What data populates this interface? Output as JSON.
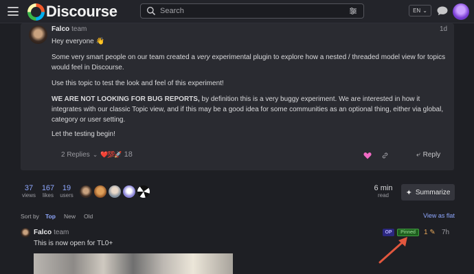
{
  "header": {
    "logo_text": "Discourse",
    "search_placeholder": "Search",
    "language": "EN"
  },
  "post": {
    "author": "Falco",
    "author_group": "team",
    "date": "1d",
    "greeting": "Hey everyone 👋",
    "para1_start": "Some very smart people on our team created a ",
    "para1_em": "very",
    "para1_end": " experimental plugin to explore how a nested / threaded model view for topics would feel in Discourse.",
    "para2": "Use this topic to test the look and feel of this experiment!",
    "para3_bold": "WE ARE NOT LOOKING FOR BUG REPORTS,",
    "para3_rest": " by definition this is a very buggy experiment. We are interested in how it integrates with our classic Topic view, and if this may be a good idea for some communities as an optional thing, either via global, category or user setting.",
    "para4": "Let the testing begin!",
    "replies_label": "2 Replies",
    "reactions": "❤️💯🚀",
    "reaction_count": "18",
    "reply_button": "Reply"
  },
  "topic_stats": {
    "views_count": "37",
    "views_label": "views",
    "likes_count": "167",
    "likes_label": "likes",
    "users_count": "19",
    "users_label": "users",
    "read_time": "6 min",
    "read_label": "read",
    "summarize_label": "Summarize"
  },
  "sort": {
    "label": "Sort by",
    "options": [
      "Top",
      "New",
      "Old"
    ],
    "active": "Top",
    "view_as_flat": "View as flat"
  },
  "reply": {
    "author": "Falco",
    "author_group": "team",
    "op_badge": "OP",
    "pinned_badge": "Pinned",
    "edit_count": "1",
    "date": "7h",
    "text": "This is now open for TL0+"
  },
  "colors": {
    "background": "#1e1f24",
    "card": "#2a2b31",
    "link": "#8fa8ff",
    "pinned": "#3ea03e",
    "arrow": "#e2573e"
  }
}
